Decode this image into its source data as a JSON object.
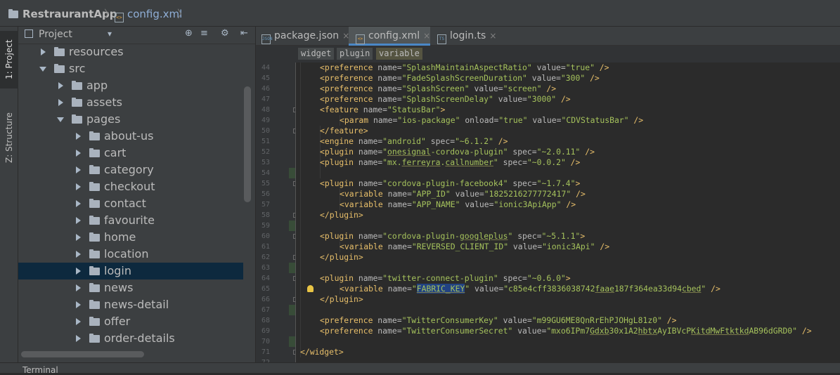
{
  "breadcrumb": {
    "project": "RestraurantApp",
    "file": "config.xml",
    "separator": "〉"
  },
  "side_tabs": {
    "project": "1: Project",
    "structure": "Z: Structure"
  },
  "project_panel": {
    "title": "Project",
    "dropdown_glyph": "▾",
    "icons": {
      "locate": "⊕",
      "collapse": "≡",
      "settings": "⚙",
      "hide": "⇤"
    },
    "tree": [
      {
        "label": "resources",
        "state": "collapsed",
        "depth": 1
      },
      {
        "label": "src",
        "state": "expanded",
        "depth": 1
      },
      {
        "label": "app",
        "state": "collapsed",
        "depth": 2
      },
      {
        "label": "assets",
        "state": "collapsed",
        "depth": 2
      },
      {
        "label": "pages",
        "state": "expanded",
        "depth": 2
      },
      {
        "label": "about-us",
        "state": "collapsed",
        "depth": 3
      },
      {
        "label": "cart",
        "state": "collapsed",
        "depth": 3
      },
      {
        "label": "category",
        "state": "collapsed",
        "depth": 3
      },
      {
        "label": "checkout",
        "state": "collapsed",
        "depth": 3
      },
      {
        "label": "contact",
        "state": "collapsed",
        "depth": 3
      },
      {
        "label": "favourite",
        "state": "collapsed",
        "depth": 3
      },
      {
        "label": "home",
        "state": "collapsed",
        "depth": 3
      },
      {
        "label": "location",
        "state": "collapsed",
        "depth": 3
      },
      {
        "label": "login",
        "state": "collapsed",
        "depth": 3,
        "selected": true
      },
      {
        "label": "news",
        "state": "collapsed",
        "depth": 3
      },
      {
        "label": "news-detail",
        "state": "collapsed",
        "depth": 3
      },
      {
        "label": "offer",
        "state": "collapsed",
        "depth": 3
      },
      {
        "label": "order-details",
        "state": "collapsed",
        "depth": 3
      }
    ]
  },
  "tabs": [
    {
      "label": "package.json",
      "icon": "json-file-icon",
      "close": "×",
      "active": false
    },
    {
      "label": "config.xml",
      "icon": "xml-file-icon",
      "close": "×",
      "active": true
    },
    {
      "label": "login.ts",
      "icon": "ts-file-icon",
      "close": "×",
      "active": false
    }
  ],
  "xml_path": [
    "widget",
    "plugin",
    "variable"
  ],
  "code_lines": [
    {
      "n": "44",
      "i": 1,
      "h": "<span class=\"tg\">&lt;preference</span> <span class=\"at\">name=</span><span class=\"vl\">\"SplashMaintainAspectRatio\"</span> <span class=\"at\">value=</span><span class=\"vl\">\"true\"</span> <span class=\"tg\">/&gt;</span>"
    },
    {
      "n": "45",
      "i": 1,
      "h": "<span class=\"tg\">&lt;preference</span> <span class=\"at\">name=</span><span class=\"vl\">\"FadeSplashScreenDuration\"</span> <span class=\"at\">value=</span><span class=\"vl\">\"300\"</span> <span class=\"tg\">/&gt;</span>"
    },
    {
      "n": "46",
      "i": 1,
      "h": "<span class=\"tg\">&lt;preference</span> <span class=\"at\">name=</span><span class=\"vl\">\"SplashScreen\"</span> <span class=\"at\">value=</span><span class=\"vl\">\"screen\"</span> <span class=\"tg\">/&gt;</span>"
    },
    {
      "n": "47",
      "i": 1,
      "h": "<span class=\"tg\">&lt;preference</span> <span class=\"at\">name=</span><span class=\"vl\">\"SplashScreenDelay\"</span> <span class=\"at\">value=</span><span class=\"vl\">\"3000\"</span> <span class=\"tg\">/&gt;</span>"
    },
    {
      "n": "48",
      "i": 1,
      "fold": true,
      "h": "<span class=\"tg\">&lt;feature</span> <span class=\"at\">name=</span><span class=\"vl\">\"StatusBar\"</span><span class=\"tg\">&gt;</span>"
    },
    {
      "n": "49",
      "i": 2,
      "h": "<span class=\"tg\">&lt;param</span> <span class=\"at\">name=</span><span class=\"vl\">\"ios-package\"</span> <span class=\"at\">onload=</span><span class=\"vl\">\"true\"</span> <span class=\"at\">value=</span><span class=\"vl\">\"CDVStatusBar\"</span> <span class=\"tg\">/&gt;</span>"
    },
    {
      "n": "50",
      "i": 1,
      "fold": true,
      "h": "<span class=\"tg\">&lt;/feature&gt;</span>"
    },
    {
      "n": "51",
      "i": 1,
      "h": "<span class=\"tg\">&lt;engine</span> <span class=\"at\">name=</span><span class=\"vl\">\"android\"</span> <span class=\"at\">spec=</span><span class=\"vl\">\"~6.1.2\"</span> <span class=\"tg\">/&gt;</span>"
    },
    {
      "n": "52",
      "i": 1,
      "h": "<span class=\"tg\">&lt;plugin</span> <span class=\"at\">name=</span><span class=\"vl\">\"<span class=\"ul\">onesignal</span>-cordova-plugin\"</span> <span class=\"at\">spec=</span><span class=\"vl\">\"~2.0.11\"</span> <span class=\"tg\">/&gt;</span>"
    },
    {
      "n": "53",
      "i": 1,
      "h": "<span class=\"tg\">&lt;plugin</span> <span class=\"at\">name=</span><span class=\"vl\">\"mx.<span class=\"ul\">ferreyra</span>.<span class=\"ul\">callnumber</span>\"</span> <span class=\"at\">spec=</span><span class=\"vl\">\"~0.0.2\"</span> <span class=\"tg\">/&gt;</span>"
    },
    {
      "n": "54",
      "i": 0,
      "mark": true,
      "h": ""
    },
    {
      "n": "55",
      "i": 1,
      "fold": true,
      "h": "<span class=\"tg\">&lt;plugin</span> <span class=\"at\">name=</span><span class=\"vl\">\"cordova-plugin-facebook4\"</span> <span class=\"at\">spec=</span><span class=\"vl\">\"~1.7.4\"</span><span class=\"tg\">&gt;</span>"
    },
    {
      "n": "56",
      "i": 2,
      "h": "<span class=\"tg\">&lt;variable</span> <span class=\"at\">name=</span><span class=\"vl\">\"APP_ID\"</span> <span class=\"at\">value=</span><span class=\"vl\">\"1825216277772417\"</span> <span class=\"tg\">/&gt;</span>"
    },
    {
      "n": "57",
      "i": 2,
      "h": "<span class=\"tg\">&lt;variable</span> <span class=\"at\">name=</span><span class=\"vl\">\"APP_NAME\"</span> <span class=\"at\">value=</span><span class=\"vl\">\"ionic3ApiApp\"</span> <span class=\"tg\">/&gt;</span>"
    },
    {
      "n": "58",
      "i": 1,
      "fold": true,
      "h": "<span class=\"tg\">&lt;/plugin&gt;</span>"
    },
    {
      "n": "59",
      "i": 0,
      "mark": true,
      "h": ""
    },
    {
      "n": "60",
      "i": 1,
      "fold": true,
      "h": "<span class=\"tg\">&lt;plugin</span> <span class=\"at\">name=</span><span class=\"vl\">\"cordova-plugin-<span class=\"ul\">googleplus</span>\"</span> <span class=\"at\">spec=</span><span class=\"vl\">\"~5.1.1\"</span><span class=\"tg\">&gt;</span>"
    },
    {
      "n": "61",
      "i": 2,
      "h": "<span class=\"tg\">&lt;variable</span> <span class=\"at\">name=</span><span class=\"vl\">\"REVERSED_CLIENT_ID\"</span> <span class=\"at\">value=</span><span class=\"vl\">\"ionic3Api\"</span> <span class=\"tg\">/&gt;</span>"
    },
    {
      "n": "62",
      "i": 1,
      "fold": true,
      "h": "<span class=\"tg\">&lt;/plugin&gt;</span>"
    },
    {
      "n": "63",
      "i": 0,
      "mark": true,
      "h": ""
    },
    {
      "n": "64",
      "i": 1,
      "fold": true,
      "h": "<span class=\"tg\">&lt;plugin</span> <span class=\"at\">name=</span><span class=\"vl\">\"twitter-connect-plugin\"</span> <span class=\"at\">spec=</span><span class=\"vl\">\"~0.6.0\"</span><span class=\"tg\">&gt;</span>"
    },
    {
      "n": "65",
      "i": 2,
      "bulb": true,
      "h": "<span class=\"tg\">&lt;variable</span> <span class=\"at\">name=</span><span class=\"vl\">\"<span class=\"hl ul\">FABRIC_KEY</span>\"</span> <span class=\"at\">value=</span><span class=\"vl\">\"c85e4cff3836038742<span class=\"ul\">faae</span>187f364ea33d94<span class=\"ul\">cbed</span>\"</span> <span class=\"tg\">/&gt;</span>"
    },
    {
      "n": "66",
      "i": 1,
      "fold": true,
      "h": "<span class=\"tg\">&lt;/plugin&gt;</span>"
    },
    {
      "n": "67",
      "i": 0,
      "mark": true,
      "h": ""
    },
    {
      "n": "68",
      "i": 1,
      "h": "<span class=\"tg\">&lt;preference</span> <span class=\"at\">name=</span><span class=\"vl\">\"TwitterConsumerKey\"</span> <span class=\"at\">value=</span><span class=\"vl\">\"m99GU6ME8QnRrEhPJOHgL81z0\"</span> <span class=\"tg\">/&gt;</span>"
    },
    {
      "n": "69",
      "i": 1,
      "h": "<span class=\"tg\">&lt;preference</span> <span class=\"at\">name=</span><span class=\"vl\">\"TwitterConsumerSecret\"</span> <span class=\"at\">value=</span><span class=\"vl\">\"mxo6IPm7<span class=\"ul\">Gdxb</span>30x1A2<span class=\"ul\">hbtx</span>AyIBVcP<span class=\"ul\">KitdMw</span><span class=\"ul\">Ftktkd</span>AB96dGRD0\"</span> <span class=\"tg\">/&gt;</span>"
    },
    {
      "n": "70",
      "i": 0,
      "mark": true,
      "h": ""
    },
    {
      "n": "71",
      "i": 0,
      "fold": true,
      "h": "<span class=\"tg\">&lt;/widget&gt;</span>"
    },
    {
      "n": "72",
      "i": 0,
      "h": ""
    }
  ],
  "bottom": {
    "terminal": "Terminal"
  }
}
